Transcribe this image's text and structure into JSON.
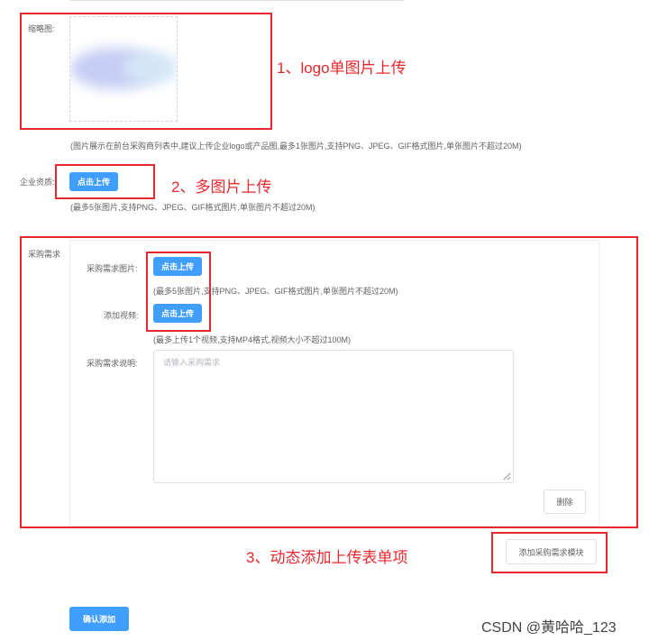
{
  "thumbnail": {
    "label": "缩略图:",
    "hint": "(图片展示在前台采购商列表中,建议上传企业logo或产品图,最多1张图片,支持PNG、JPEG、GIF格式图片,单张图片不超过20M)",
    "annotation": "1、logo单图片上传"
  },
  "qualification": {
    "label": "企业资质:",
    "upload_label": "点击上传",
    "hint": "(最多5张图片,支持PNG、JPEG、GIF格式图片,单张图片不超过20M)",
    "annotation": "2、多图片上传"
  },
  "purchase": {
    "label": "采购需求",
    "images_label": "采购需求图片:",
    "images_upload": "点击上传",
    "images_hint": "(最多5张图片,支持PNG、JPEG、GIF格式图片,单张图片不超过20M)",
    "video_label": "添加视频:",
    "video_upload": "点击上传",
    "video_hint": "(最多上传1个视频,支持MP4格式,视频大小不超过100M)",
    "desc_label": "采购需求说明:",
    "desc_value": "",
    "desc_placeholder": "请输入采购需求",
    "delete_label": "删除"
  },
  "dynamic": {
    "annotation": "3、动态添加上传表单项",
    "add_module_label": "添加采购需求模块"
  },
  "confirm_label": "确认添加",
  "watermark": "CSDN @黄哈哈_123",
  "colors": {
    "primary": "#409eff",
    "annotation_red": "#e4282d"
  }
}
